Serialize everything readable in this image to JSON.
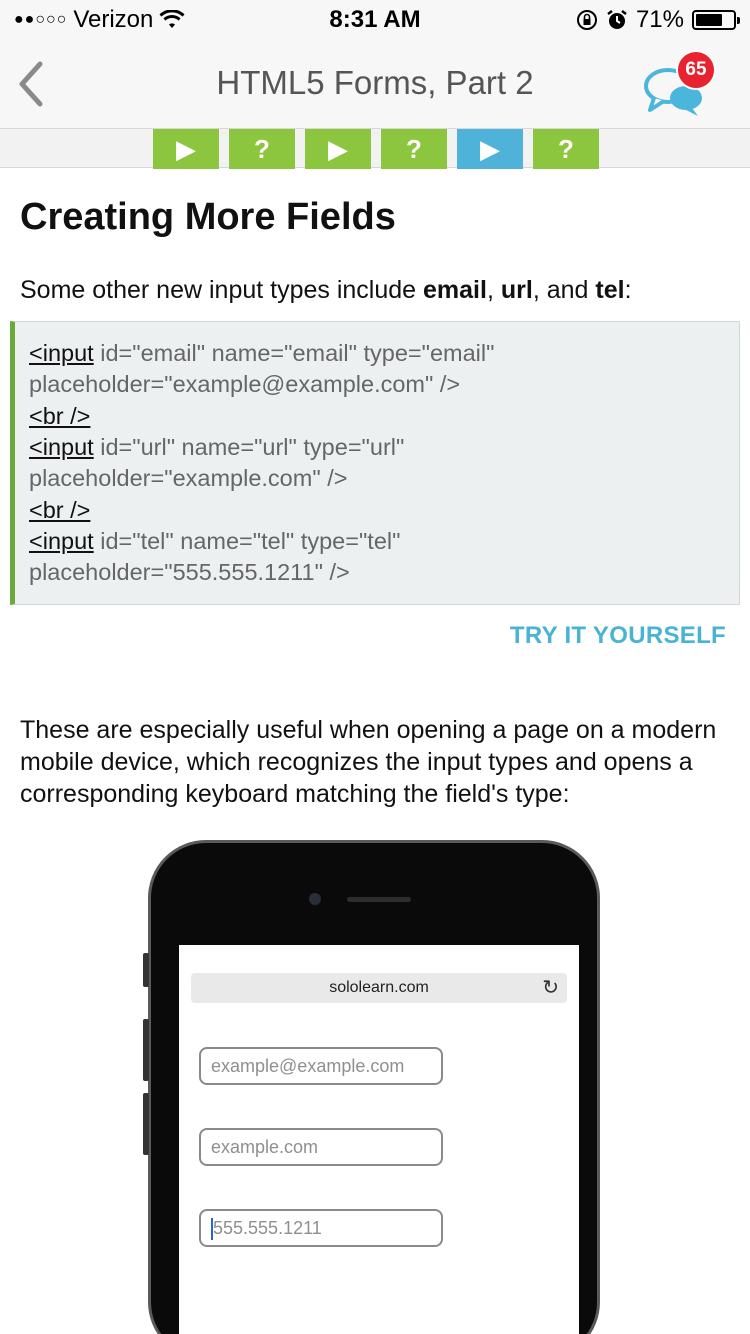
{
  "status_bar": {
    "signal": "●●○○○",
    "carrier": "Verizon",
    "time": "8:31 AM",
    "battery_percent": "71%",
    "battery_level": 0.71
  },
  "nav": {
    "title": "HTML5 Forms, Part 2",
    "badge_count": "65"
  },
  "progress_steps": [
    {
      "type": "play",
      "glyph": "▶",
      "state": "done",
      "color": "#8cc63f"
    },
    {
      "type": "quiz",
      "glyph": "?",
      "state": "done",
      "color": "#8cc63f"
    },
    {
      "type": "play",
      "glyph": "▶",
      "state": "done",
      "color": "#8cc63f"
    },
    {
      "type": "quiz",
      "glyph": "?",
      "state": "done",
      "color": "#8cc63f"
    },
    {
      "type": "play",
      "glyph": "▶",
      "state": "current",
      "color": "#4fb3d9"
    },
    {
      "type": "quiz",
      "glyph": "?",
      "state": "done",
      "color": "#8cc63f"
    }
  ],
  "lesson": {
    "heading": "Creating More Fields",
    "intro": {
      "prefix": "Some other new input types include ",
      "term1": "email",
      "sep1": ", ",
      "term2": "url",
      "sep2": ", and ",
      "term3": "tel",
      "suffix": ":"
    },
    "code": {
      "line1_tag": "<input",
      "line1_rest": " id=\"email\" name=\"email\" type=\"email\"",
      "line2": "placeholder=\"example@example.com\" />",
      "line3_tag": "<br />",
      "line4_tag": "<input",
      "line4_rest": " id=\"url\" name=\"url\" type=\"url\"",
      "line5": "placeholder=\"example.com\" />",
      "line6_tag": "<br />",
      "line7_tag": "<input",
      "line7_rest": " id=\"tel\" name=\"tel\" type=\"tel\"",
      "line8": "placeholder=\"555.555.1211\" />"
    },
    "try_it": "TRY IT YOURSELF",
    "paragraph": {
      "line1": "These are especially useful when opening a page on a modern",
      "line2": "mobile device, which recognizes the input types and opens a",
      "line3": "corresponding keyboard matching the field's type:"
    }
  },
  "phone_mockup": {
    "url": "sololearn.com",
    "field_email": "example@example.com",
    "field_url": "example.com",
    "field_tel": "555.555.1211"
  },
  "colors": {
    "accent_blue": "#49b3d4",
    "step_green": "#8cc63f",
    "step_current": "#4fb3d9",
    "code_border": "#6aaa3a",
    "badge_red": "#e8222e"
  }
}
